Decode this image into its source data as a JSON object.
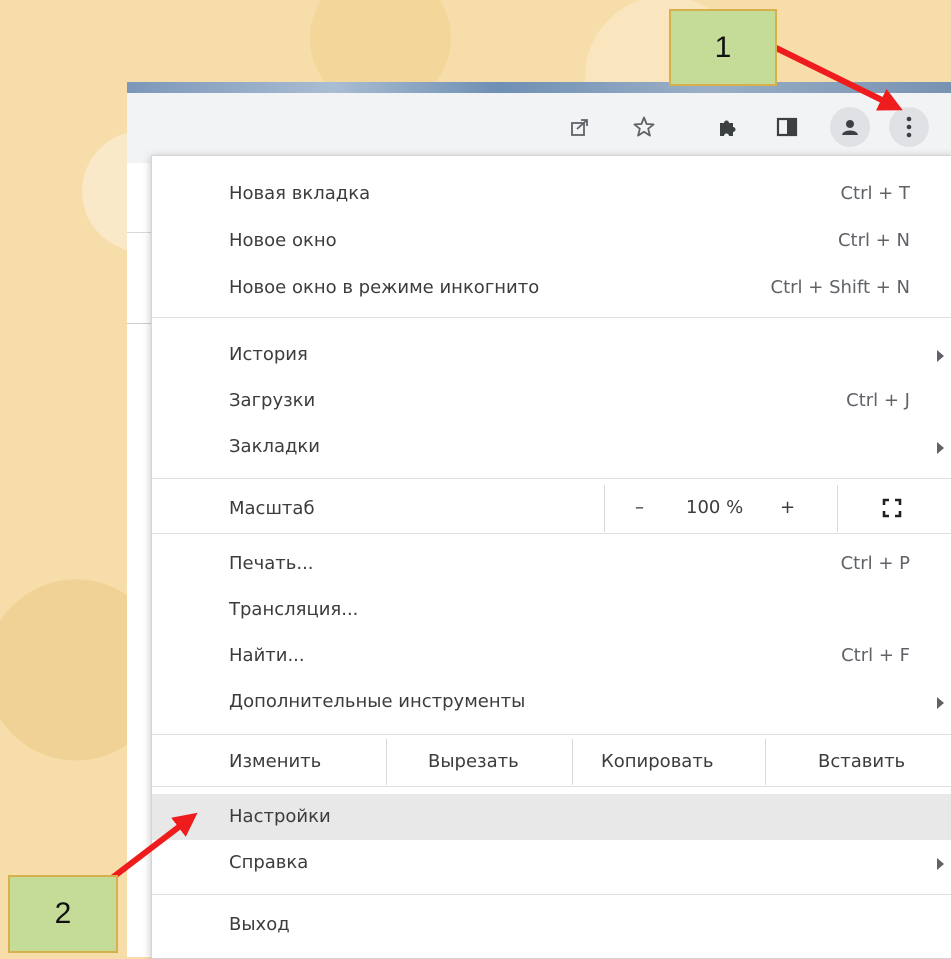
{
  "callouts": {
    "one": "1",
    "two": "2"
  },
  "toolbar": {
    "icons": [
      "share-icon",
      "bookmark-star-icon",
      "extensions-puzzle-icon",
      "side-panel-icon",
      "profile-icon",
      "menu-kebab-icon"
    ]
  },
  "menu": {
    "new_tab": {
      "label": "Новая вкладка",
      "shortcut": "Ctrl + T"
    },
    "new_window": {
      "label": "Новое окно",
      "shortcut": "Ctrl + N"
    },
    "incognito": {
      "label": "Новое окно в режиме инкогнито",
      "shortcut": "Ctrl + Shift + N"
    },
    "history": {
      "label": "История"
    },
    "downloads": {
      "label": "Загрузки",
      "shortcut": "Ctrl + J"
    },
    "bookmarks": {
      "label": "Закладки"
    },
    "zoom": {
      "label": "Масштаб",
      "minus": "–",
      "value": "100 %",
      "plus": "+"
    },
    "print": {
      "label": "Печать...",
      "shortcut": "Ctrl + P"
    },
    "cast": {
      "label": "Трансляция..."
    },
    "find": {
      "label": "Найти...",
      "shortcut": "Ctrl + F"
    },
    "more_tools": {
      "label": "Дополнительные инструменты"
    },
    "edit": {
      "label": "Изменить",
      "cut": "Вырезать",
      "copy": "Копировать",
      "paste": "Вставить"
    },
    "settings": {
      "label": "Настройки"
    },
    "help": {
      "label": "Справка"
    },
    "exit": {
      "label": "Выход"
    }
  },
  "colors": {
    "callout_fill": "#c5dc98",
    "callout_border": "#d6b04a",
    "arrow": "#ee1c1c",
    "highlight": "#e8e8e8"
  }
}
